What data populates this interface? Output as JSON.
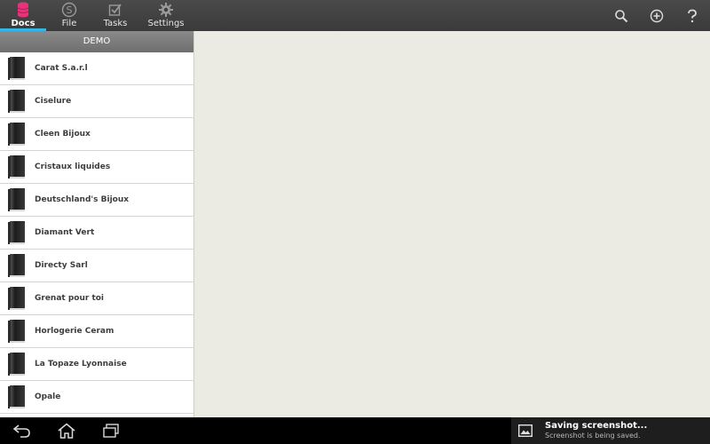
{
  "tabs": [
    {
      "label": "Docs",
      "icon": "database-icon",
      "active": true
    },
    {
      "label": "File",
      "icon": "dollar-circle-icon",
      "active": false
    },
    {
      "label": "Tasks",
      "icon": "checkbox-icon",
      "active": false
    },
    {
      "label": "Settings",
      "icon": "gear-icon",
      "active": false
    }
  ],
  "actions": [
    "search-icon",
    "add-circle-icon",
    "help-icon"
  ],
  "sidebar": {
    "header": "DEMO",
    "items": [
      {
        "label": "Carat S.a.r.l"
      },
      {
        "label": "Ciselure"
      },
      {
        "label": "Cleen Bijoux"
      },
      {
        "label": "Cristaux liquides"
      },
      {
        "label": "Deutschland's Bijoux"
      },
      {
        "label": "Diamant Vert"
      },
      {
        "label": "Directy Sarl"
      },
      {
        "label": "Grenat pour toi"
      },
      {
        "label": "Horlogerie Ceram"
      },
      {
        "label": "La Topaze Lyonnaise"
      },
      {
        "label": "Opale"
      }
    ]
  },
  "notification": {
    "title": "Saving screenshot...",
    "subtitle": "Screenshot is being saved."
  },
  "colors": {
    "accent": "#33b5e5",
    "docs_icon": "#e6337a",
    "topbar": "#3f3f3f",
    "content_bg": "#ebebe4"
  }
}
